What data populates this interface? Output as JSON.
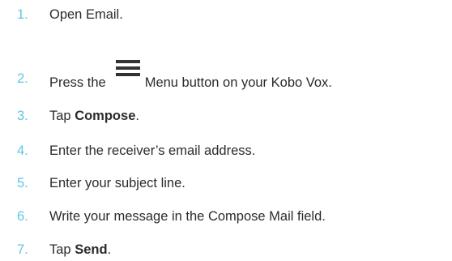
{
  "steps": [
    {
      "number": "1.",
      "parts": [
        "Open Email."
      ]
    },
    {
      "number": "2.",
      "parts": [
        "Press the",
        "Menu button on your Kobo Vox."
      ],
      "icon": "menu-icon"
    },
    {
      "number": "3.",
      "parts": [
        "Tap ",
        "Compose",
        "."
      ]
    },
    {
      "number": "4.",
      "parts": [
        "Enter the receiver’s email address."
      ]
    },
    {
      "number": "5.",
      "parts": [
        "Enter your subject line."
      ]
    },
    {
      "number": "6.",
      "parts": [
        "Write your message in the Compose Mail field."
      ]
    },
    {
      "number": "7.",
      "parts": [
        "Tap ",
        "Send",
        "."
      ]
    }
  ],
  "colors": {
    "number": "#5fc7e2",
    "text": "#2b2b2b"
  }
}
